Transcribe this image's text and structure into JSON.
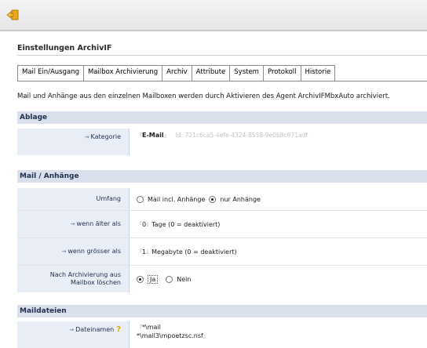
{
  "header": {
    "title": "Einstellungen ArchivIF"
  },
  "tabs": [
    {
      "label": "Mail Ein/Ausgang"
    },
    {
      "label": "Mailbox Archivierung"
    },
    {
      "label": "Archiv"
    },
    {
      "label": "Attribute"
    },
    {
      "label": "System"
    },
    {
      "label": "Protokoll"
    },
    {
      "label": "Historie"
    }
  ],
  "description": "Mail und Anhänge aus den einzelnen Mailboxen werden durch Aktivieren des Agent ArchivIFMbxAuto archiviert.",
  "ablage": {
    "heading": "Ablage",
    "kategorie_label": "Kategorie",
    "kategorie_value": "E-Mail",
    "kategorie_id": "Id: 721c6ca5-4efe-4324-8558-9e0b8c871adf"
  },
  "mail": {
    "heading": "Mail / Anhänge",
    "umfang_label": "Umfang",
    "umfang_opt1": "Mail incl. Anhänge",
    "umfang_opt2": "nur Anhänge",
    "aelter_label": "wenn älter als",
    "aelter_value": "0",
    "aelter_unit": "Tage (0 = deaktiviert)",
    "groesser_label": "wenn grösser als",
    "groesser_value": "1",
    "groesser_unit": "Megabyte (0 = deaktiviert)",
    "loeschen_label_1": "Nach Archivierung aus",
    "loeschen_label_2": "Mailbox löschen",
    "loeschen_ja": "Ja",
    "loeschen_nein": "Nein"
  },
  "maildateien": {
    "heading": "Maildateien",
    "dateinamen_label": "Dateinamen",
    "dateinamen_line1": "*\\mail",
    "dateinamen_line2": "*\\mail3\\mpoetzsc.nsf"
  },
  "icons": {
    "toolbar": "back-arrow-icon",
    "help": "help-icon"
  }
}
